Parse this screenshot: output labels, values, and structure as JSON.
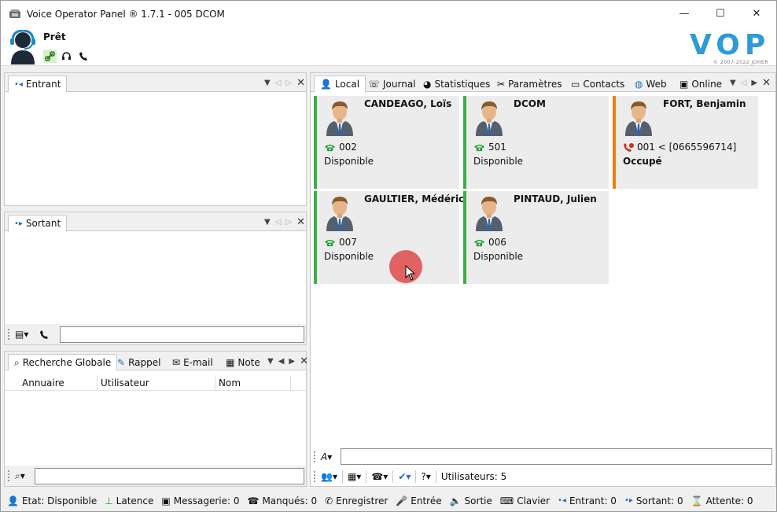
{
  "window": {
    "title": "Voice Operator Panel ® 1.7.1 - 005 DCOM",
    "minimize": "—",
    "maximize": "☐",
    "close": "✕"
  },
  "header": {
    "status": "Prêt",
    "logo": "VOP",
    "copyright": "© 2007-2022 JOHER"
  },
  "panels": {
    "incoming": {
      "tab": "Entrant"
    },
    "outgoing": {
      "tab": "Sortant"
    },
    "search": {
      "tabs": [
        "Recherche Globale",
        "Rappel",
        "E-mail",
        "Note"
      ],
      "columns": [
        "Annuaire",
        "Utilisateur",
        "Nom"
      ]
    }
  },
  "right": {
    "tabs": [
      "Local",
      "Journal",
      "Statistiques",
      "Paramètres",
      "Contacts",
      "Web",
      "Online"
    ],
    "cards": [
      {
        "name": "CANDEAGO, Loïs",
        "ext": "002",
        "state": "Disponible",
        "status": "available"
      },
      {
        "name": "DCOM",
        "ext": "501",
        "state": "Disponible",
        "status": "available"
      },
      {
        "name": "FORT, Benjamin",
        "ext": "001 < [0665596714]",
        "state": "Occupé",
        "status": "busy"
      },
      {
        "name": "GAULTIER, Médérick",
        "ext": "007",
        "state": "Disponible",
        "status": "available"
      },
      {
        "name": "PINTAUD, Julien",
        "ext": "006",
        "state": "Disponible",
        "status": "available"
      }
    ],
    "users_count": "Utilisateurs: 5"
  },
  "statusbar": {
    "etat": "Etat: Disponible",
    "latence": "Latence",
    "messagerie": "Messagerie: 0",
    "manques": "Manqués: 0",
    "enregistrer": "Enregistrer",
    "entree": "Entrée",
    "sortie": "Sortie",
    "clavier": "Clavier",
    "entrant": "Entrant: 0",
    "sortant": "Sortant: 0",
    "attente": "Attente: 0"
  },
  "colors": {
    "available": "#3cb043",
    "busy": "#f07f00",
    "logo": "#2e9ad6",
    "phone_green": "#1a9e2c",
    "phone_red": "#d9261c"
  }
}
